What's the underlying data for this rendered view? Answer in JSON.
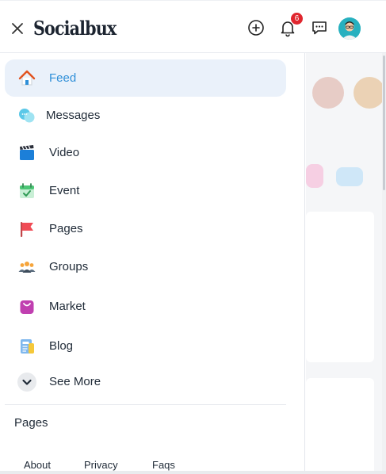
{
  "header": {
    "logo": "Socialbux",
    "notification_count": "6"
  },
  "menu": {
    "items": [
      {
        "label": "Feed",
        "icon": "home-icon",
        "active": true
      },
      {
        "label": "Messages",
        "icon": "chat-bubbles-icon"
      },
      {
        "label": "Video",
        "icon": "clapperboard-icon"
      },
      {
        "label": "Event",
        "icon": "calendar-check-icon"
      },
      {
        "label": "Pages",
        "icon": "flag-icon"
      },
      {
        "label": "Groups",
        "icon": "people-icon"
      },
      {
        "label": "Market",
        "icon": "shopping-bag-icon"
      },
      {
        "label": "Blog",
        "icon": "newspaper-icon"
      },
      {
        "label": "See More",
        "icon": "chevron-down-icon"
      }
    ],
    "section_title": "Pages",
    "footer_links": [
      "About",
      "Privacy",
      "Faqs"
    ]
  },
  "colors": {
    "accent": "#2f8fd8",
    "active_bg": "#eaf1fa",
    "badge": "#e0262e"
  }
}
